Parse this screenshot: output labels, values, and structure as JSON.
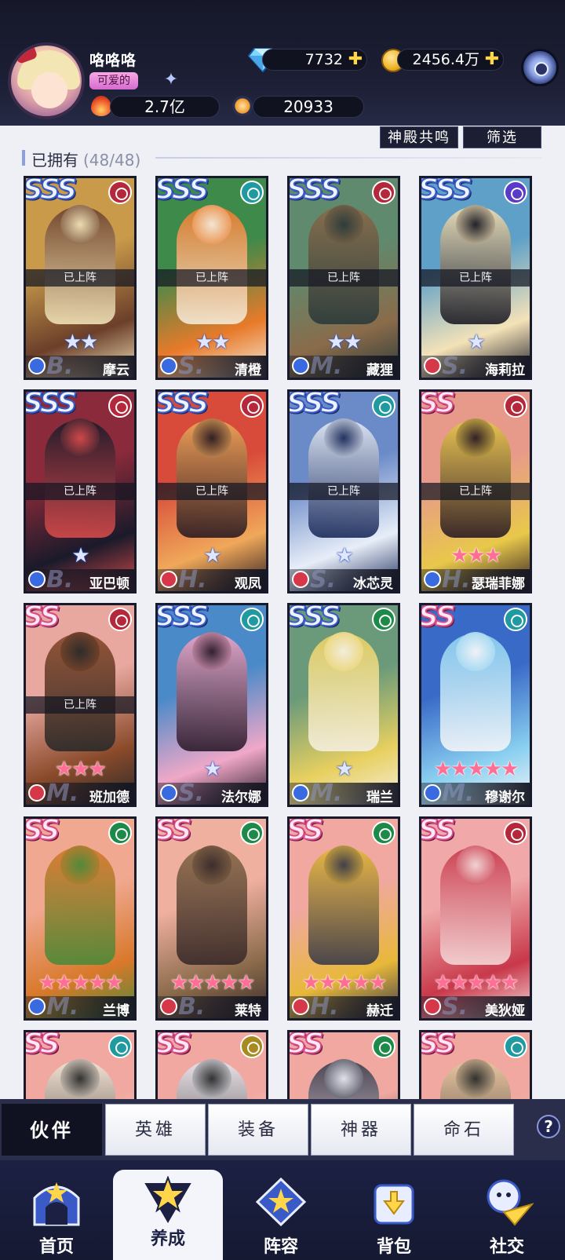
{
  "player": {
    "name": "咯咯咯",
    "title": "可爱的",
    "power": "2.7亿",
    "score": "20933"
  },
  "currency": {
    "gems": "7732",
    "gold": "2456.4万"
  },
  "toolbar": {
    "resonance": "神殿共鸣",
    "filter": "筛选"
  },
  "owned": {
    "label": "已拥有",
    "count": "(48/48)"
  },
  "deployed_label": "已上阵",
  "cards": [
    {
      "rank": "SSS",
      "name": "摩云",
      "tier": "B.",
      "element": "fire",
      "cls": "dragon",
      "stars": 2,
      "star_color": "blue",
      "deployed": true,
      "colors": [
        "#c89a4a",
        "#6b3f2a",
        "#f0e2b8"
      ]
    },
    {
      "rank": "SSS",
      "name": "清橙",
      "tier": "S.",
      "element": "water",
      "cls": "heart",
      "stars": 2,
      "star_color": "blue",
      "deployed": true,
      "colors": [
        "#3e8a4a",
        "#e87a2a",
        "#f4ead8"
      ]
    },
    {
      "rank": "SSS",
      "name": "藏狸",
      "tier": "M.",
      "element": "fire",
      "cls": "heart",
      "stars": 2,
      "star_color": "blue",
      "deployed": true,
      "colors": [
        "#5f8a6e",
        "#8a6b4a",
        "#2a3a3a"
      ]
    },
    {
      "rank": "SSS",
      "name": "海莉拉",
      "tier": "S.",
      "element": "dark",
      "cls": "heart-red",
      "stars": 1,
      "star_color": "blue",
      "deployed": true,
      "colors": [
        "#5ea0c8",
        "#f4e2b8",
        "#1a1a24"
      ]
    },
    {
      "rank": "SSS",
      "name": "亚巴顿",
      "tier": "B.",
      "element": "fire",
      "cls": "shield",
      "stars": 1,
      "star_color": "blue",
      "deployed": true,
      "colors": [
        "#8a2a3a",
        "#1a1a2a",
        "#d64a4a"
      ]
    },
    {
      "rank": "SSS",
      "name": "观凤",
      "tier": "H.",
      "element": "fire",
      "cls": "shield-red",
      "stars": 1,
      "star_color": "blue",
      "deployed": true,
      "colors": [
        "#d84a3a",
        "#f0a85a",
        "#2a1a22"
      ]
    },
    {
      "rank": "SSS",
      "name": "冰芯灵",
      "tier": "S.",
      "element": "water",
      "cls": "bow",
      "stars": 1,
      "star_color": "blue",
      "deployed": true,
      "colors": [
        "#6a8ac8",
        "#e8eef8",
        "#1a2a5a"
      ]
    },
    {
      "rank": "SS",
      "name": "瑟瑞菲娜",
      "tier": "H.",
      "element": "fire",
      "cls": "bow-blue",
      "stars": 3,
      "star_color": "pink",
      "deployed": true,
      "colors": [
        "#e89a8a",
        "#e8c84a",
        "#2a1a24"
      ]
    },
    {
      "rank": "SS",
      "name": "班加德",
      "tier": "M.",
      "element": "fire",
      "cls": "bow-red",
      "stars": 3,
      "star_color": "pink",
      "deployed": true,
      "colors": [
        "#e8a8a0",
        "#8a4a2a",
        "#2a2a2a"
      ]
    },
    {
      "rank": "SSS",
      "name": "法尔娜",
      "tier": "S.",
      "element": "water",
      "cls": "bow-blue",
      "stars": 1,
      "star_color": "blue",
      "deployed": false,
      "colors": [
        "#4a8ac8",
        "#f0a8c8",
        "#2a1a2a"
      ]
    },
    {
      "rank": "SSS",
      "name": "瑞兰",
      "tier": "M.",
      "element": "nature",
      "cls": "heart",
      "stars": 1,
      "star_color": "blue",
      "deployed": false,
      "colors": [
        "#6a9a7a",
        "#e8d060",
        "#f4eee0"
      ]
    },
    {
      "rank": "SS",
      "name": "穆谢尔",
      "tier": "M.",
      "element": "water",
      "cls": "bow-blue",
      "stars": 5,
      "star_color": "pink",
      "deployed": false,
      "colors": [
        "#3a6ac8",
        "#8ad0f0",
        "#f4f4f8"
      ]
    },
    {
      "rank": "SS",
      "name": "兰博",
      "tier": "M.",
      "element": "nature",
      "cls": "dragon",
      "stars": 5,
      "star_color": "pink",
      "deployed": false,
      "colors": [
        "#f0a890",
        "#d8782a",
        "#4a8a3a"
      ]
    },
    {
      "rank": "SS",
      "name": "莱特",
      "tier": "B.",
      "element": "nature",
      "cls": "bow-red",
      "stars": 5,
      "star_color": "pink",
      "deployed": false,
      "colors": [
        "#f0b0a0",
        "#8a6a4a",
        "#3a2a2a"
      ]
    },
    {
      "rank": "SS",
      "name": "赫迁",
      "tier": "H.",
      "element": "nature",
      "cls": "shield-red",
      "stars": 5,
      "star_color": "pink",
      "deployed": false,
      "colors": [
        "#f0a8a0",
        "#e8b83a",
        "#3a3a4a"
      ]
    },
    {
      "rank": "SS",
      "name": "美狄娅",
      "tier": "S.",
      "element": "fire",
      "cls": "bow-red",
      "stars": 5,
      "star_color": "pink",
      "deployed": false,
      "colors": [
        "#f0a8a8",
        "#c8384a",
        "#f4d8d8"
      ]
    },
    {
      "rank": "SS",
      "name": "",
      "tier": "",
      "element": "water",
      "cls": "",
      "stars": 0,
      "star_color": "pink",
      "deployed": false,
      "colors": [
        "#f0a8a0",
        "#f4e8d8",
        "#2a2a2a"
      ]
    },
    {
      "rank": "SS",
      "name": "",
      "tier": "",
      "element": "light",
      "cls": "",
      "stars": 0,
      "star_color": "pink",
      "deployed": false,
      "colors": [
        "#f0a8a0",
        "#e8e8f0",
        "#2a2a2a"
      ]
    },
    {
      "rank": "SS",
      "name": "",
      "tier": "",
      "element": "nature",
      "cls": "",
      "stars": 0,
      "star_color": "pink",
      "deployed": false,
      "colors": [
        "#f0a8a0",
        "#3a3a4a",
        "#e8e8f0"
      ]
    },
    {
      "rank": "SS",
      "name": "",
      "tier": "",
      "element": "water",
      "cls": "",
      "stars": 0,
      "star_color": "pink",
      "deployed": false,
      "colors": [
        "#f0a8a0",
        "#e8c8a0",
        "#2a2a2a"
      ]
    }
  ],
  "element_colors": {
    "fire": "#b5273a",
    "water": "#1e9aa0",
    "dark": "#5a3ac8",
    "nature": "#1e8a4a",
    "light": "#a88a20"
  },
  "class_colors": {
    "dragon": "#3a6ae0",
    "heart": "#3a6ae0",
    "heart-red": "#d6384a",
    "shield": "#3a6ae0",
    "shield-red": "#d6384a",
    "bow": "#d6384a",
    "bow-blue": "#3a6ae0",
    "bow-red": "#d6384a"
  },
  "subtabs": [
    {
      "label": "伙伴",
      "active": true
    },
    {
      "label": "英雄",
      "active": false
    },
    {
      "label": "装备",
      "active": false
    },
    {
      "label": "神器",
      "active": false
    },
    {
      "label": "命石",
      "active": false
    }
  ],
  "help_label": "?",
  "nav": [
    {
      "label": "首页",
      "icon": "home-icon",
      "active": false
    },
    {
      "label": "养成",
      "icon": "develop-icon",
      "active": true
    },
    {
      "label": "阵容",
      "icon": "lineup-icon",
      "active": false
    },
    {
      "label": "背包",
      "icon": "bag-icon",
      "active": false
    },
    {
      "label": "社交",
      "icon": "social-icon",
      "active": false
    }
  ]
}
